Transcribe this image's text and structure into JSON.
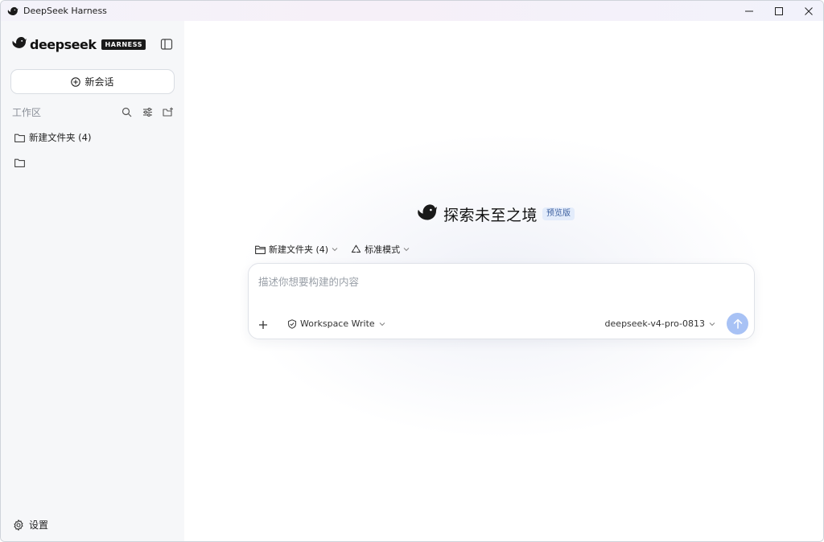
{
  "window": {
    "title": "DeepSeek Harness",
    "controls": [
      "minimize-icon",
      "maximize-icon",
      "close-icon"
    ]
  },
  "sidebar": {
    "brand_name": "deepseek",
    "brand_tag": "HARNESS",
    "new_chat_label": "新会话",
    "workspace_label": "工作区",
    "workspace_tools": [
      "search-icon",
      "filter-icon",
      "new-folder-icon"
    ],
    "folders": [
      {
        "label": "新建文件夹 (4)"
      },
      {
        "label": ""
      }
    ],
    "settings_label": "设置"
  },
  "main": {
    "hero_title": "探索未至之境",
    "hero_badge": "预览版",
    "context": {
      "folder_label": "新建文件夹 (4)",
      "mode_label": "标准模式"
    },
    "composer": {
      "placeholder": "描述你想要构建的内容",
      "value": "",
      "permission_label": "Workspace Write",
      "model_label": "deepseek-v4-pro-0813"
    }
  },
  "colors": {
    "accent": "#a8c2f5",
    "sidebar_bg": "#f6f7f9",
    "badge_bg": "#e3ecfb",
    "badge_text": "#3c5f9f"
  }
}
